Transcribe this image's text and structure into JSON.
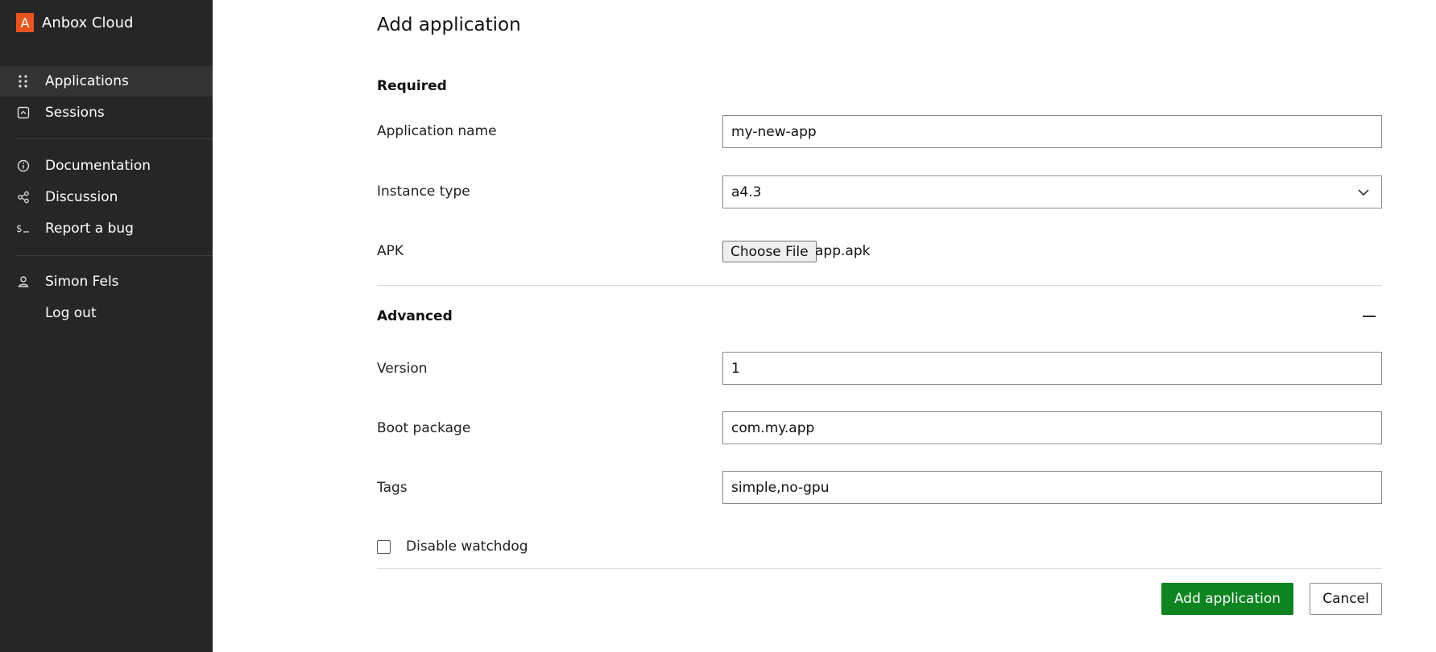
{
  "brand": {
    "logo_letter": "A",
    "name": "Anbox Cloud",
    "logo_color": "#e95420"
  },
  "sidebar": {
    "nav": [
      {
        "label": "Applications",
        "icon": "apps-grid-icon"
      },
      {
        "label": "Sessions",
        "icon": "session-icon"
      }
    ],
    "resources": [
      {
        "label": "Documentation",
        "icon": "info-icon"
      },
      {
        "label": "Discussion",
        "icon": "share-icon"
      },
      {
        "label": "Report a bug",
        "icon": "terminal-icon"
      }
    ],
    "account": [
      {
        "label": "Simon Fels",
        "icon": "user-icon"
      },
      {
        "label": "Log out",
        "icon": ""
      }
    ]
  },
  "page": {
    "title": "Add application"
  },
  "required": {
    "heading": "Required",
    "app_name": {
      "label": "Application name",
      "value": "my-new-app"
    },
    "instance_type": {
      "label": "Instance type",
      "value": "a4.3"
    },
    "apk": {
      "label": "APK",
      "button": "Choose File",
      "file": "app.apk"
    }
  },
  "advanced": {
    "heading": "Advanced",
    "version": {
      "label": "Version",
      "value": "1"
    },
    "boot_package": {
      "label": "Boot package",
      "value": "com.my.app"
    },
    "tags": {
      "label": "Tags",
      "value": "simple,no-gpu"
    },
    "disable_watchdog": {
      "label": "Disable watchdog",
      "checked": false
    }
  },
  "actions": {
    "submit": "Add application",
    "cancel": "Cancel",
    "submit_color": "#0e8420"
  },
  "colors": {
    "sidebar_bg": "#262626",
    "active_item_bg": "#333333"
  }
}
